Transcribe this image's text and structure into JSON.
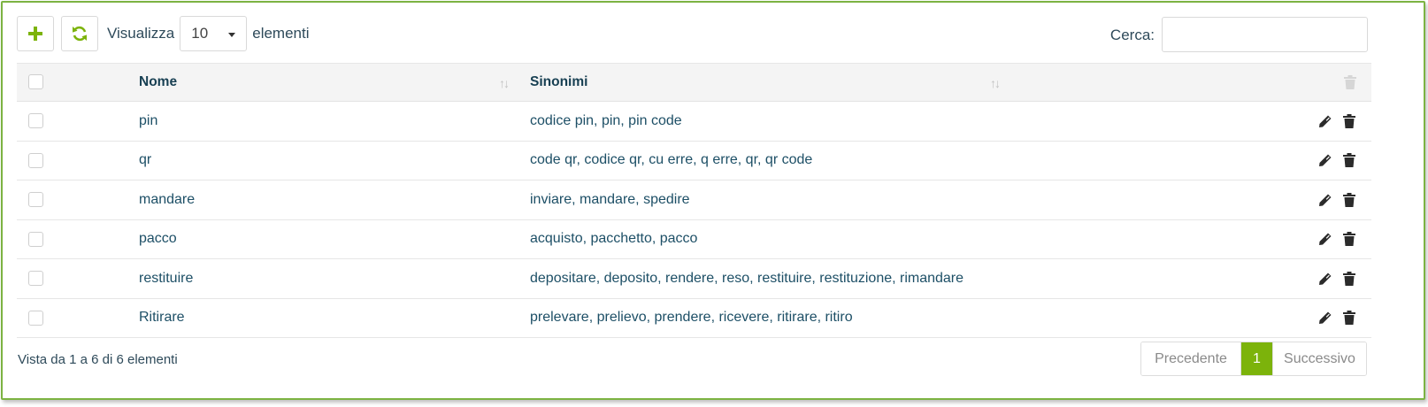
{
  "colors": {
    "accent": "#7cb30b",
    "border": "#7cb342",
    "text": "#1d4f66",
    "icon": "#2b2b2b",
    "muted": "#c9c9c9"
  },
  "toolbar": {
    "add_icon": "plus-icon",
    "refresh_icon": "refresh-icon",
    "show_label": "Visualizza",
    "page_length": "10",
    "items_label": "elementi"
  },
  "search": {
    "label": "Cerca:",
    "value": "",
    "placeholder": ""
  },
  "table": {
    "columns": [
      "Nome",
      "Sinonimi"
    ],
    "rows": [
      {
        "name": "pin",
        "synonyms": "codice pin, pin, pin code"
      },
      {
        "name": "qr",
        "synonyms": "code qr, codice qr, cu erre, q erre, qr, qr code"
      },
      {
        "name": "mandare",
        "synonyms": "inviare, mandare, spedire"
      },
      {
        "name": "pacco",
        "synonyms": "acquisto, pacchetto, pacco"
      },
      {
        "name": "restituire",
        "synonyms": "depositare, deposito, rendere, reso, restituire, restituzione, rimandare"
      },
      {
        "name": "Ritirare",
        "synonyms": "prelevare, prelievo, prendere, ricevere, ritirare, ritiro"
      }
    ]
  },
  "footer": {
    "info": "Vista da 1 a 6 di 6 elementi",
    "prev_label": "Precedente",
    "current_page": "1",
    "next_label": "Successivo"
  }
}
